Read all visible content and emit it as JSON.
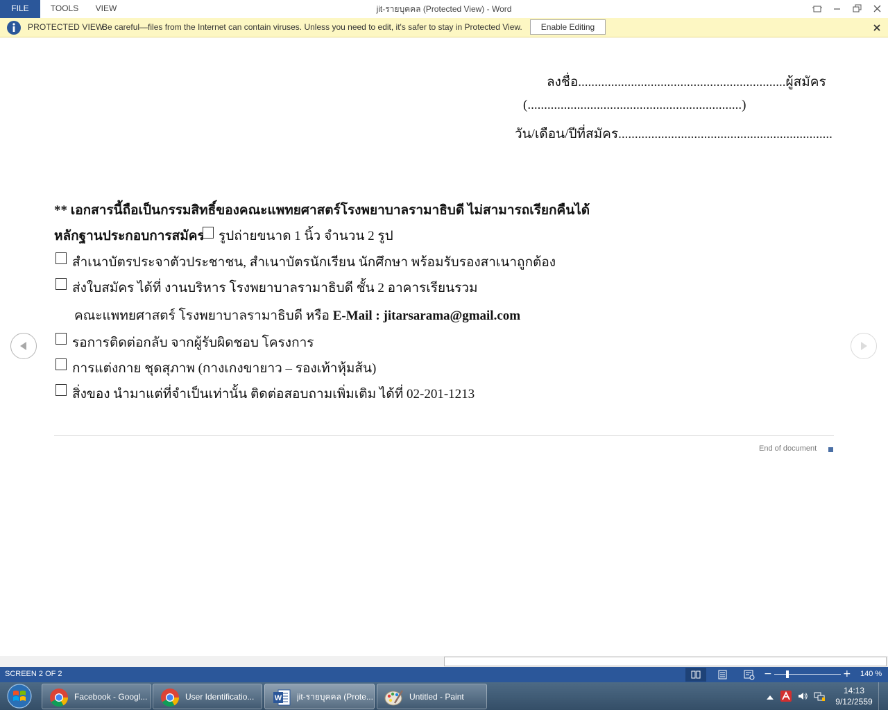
{
  "titlebar": {
    "menu": {
      "file": "FILE",
      "tools": "TOOLS",
      "view": "VIEW"
    },
    "window_title": "jit-รายบุคคล (Protected View) - Word"
  },
  "protected_view": {
    "title": "PROTECTED VIEW",
    "message": "Be careful—files from the Internet can contain viruses. Unless you need to edit, it's safer to stay in Protected View.",
    "button": "Enable Editing"
  },
  "document": {
    "signature_line": "ลงชื่อ...............................................................ผู้สมัคร",
    "name_line": "(.................................................................)",
    "date_line": "วัน/เดือน/ปีที่สมัคร.................................................................",
    "copyright_note": "** เอกสารนี้ถือเป็นกรรมสิทธิ์ของคณะแพทยศาสตร์โรงพยาบาลรามาธิบดี ไม่สามารถเรียกคืนได้",
    "evidence_heading": "หลักฐานประกอบการสมัคร",
    "evidence_photo": "รูปถ่ายขนาด 1 นิ้ว จำนวน 2 รูป",
    "items": {
      "id_copy": "สำเนาบัตรประจาตัวประชาชน, สำเนาบัตรนักเรียน นักศึกษา พร้อมรับรองสาเนาถูกต้อง",
      "submit": "ส่งใบสมัคร ได้ที่ งานบริหาร โรงพยาบาลรามาธิบดี ชั้น 2  อาคารเรียนรวม",
      "submit_cont": "คณะแพทยศาสตร์ โรงพยาบาลรามาธิบดี  หรือ",
      "email": "E-Mail : jitarsarama@gmail.com",
      "contact_wait": "รอการติดต่อกลับ จากผู้รับผิดชอบ โครงการ",
      "dress": "การแต่งกาย ชุดสุภาพ (กางเกงขายาว – รองเท้าหุ้มส้น)",
      "belongings": "สิ่งของ นำมาแต่ที่จำเป็นเท่านั้น ติดต่อสอบถามเพิ่มเติม ได้ที่ 02-201-1213"
    },
    "end_of_document": "End of document"
  },
  "statusbar": {
    "screen": "SCREEN 2 OF 2",
    "zoom": "140 %",
    "zoom_level": 1.4
  },
  "taskbar": {
    "items": [
      {
        "label": "Facebook - Googl...",
        "icon": "chrome-icon"
      },
      {
        "label": "User Identificatio...",
        "icon": "chrome-icon"
      },
      {
        "label": "jit-รายบุคคล (Prote...",
        "icon": "word-icon"
      },
      {
        "label": "Untitled - Paint",
        "icon": "paint-icon"
      }
    ],
    "clock": {
      "time": "14:13",
      "date": "9/12/2559"
    }
  },
  "colors": {
    "word_blue": "#2b579a",
    "protected_bar": "#fdf7c3",
    "taskbar": "#3f5a75"
  }
}
